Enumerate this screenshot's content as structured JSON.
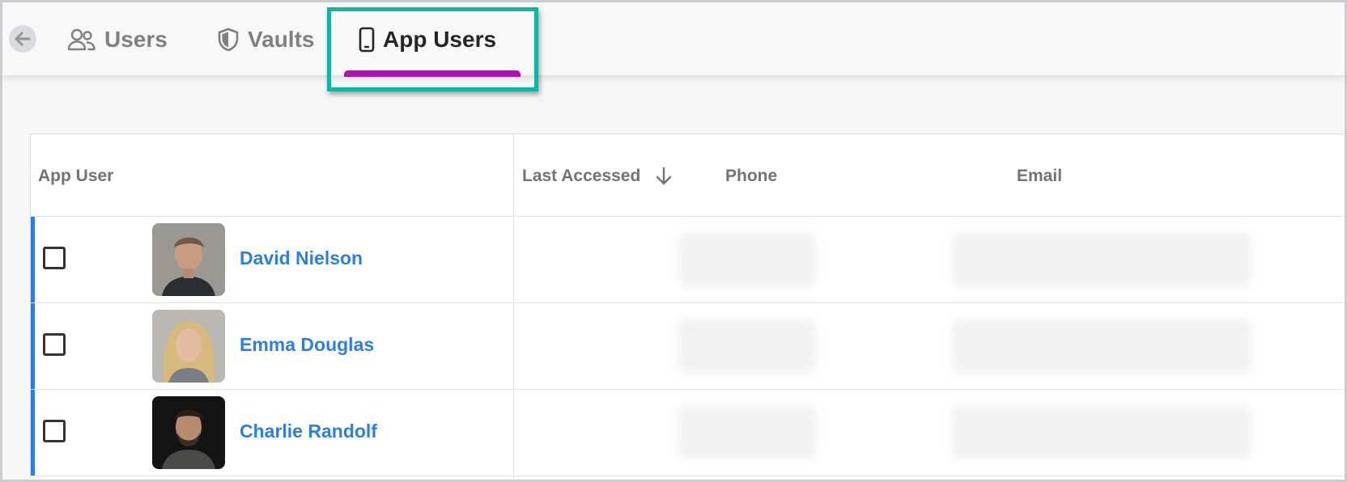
{
  "nav": {
    "back_icon": "arrow-left-icon",
    "tabs": [
      {
        "label": "Users",
        "icon": "users-icon",
        "active": false
      },
      {
        "label": "Vaults",
        "icon": "shield-icon",
        "active": false
      },
      {
        "label": "App Users",
        "icon": "mobile-phone-icon",
        "active": true
      }
    ],
    "accent_color": "#b50fb0",
    "highlight_color": "#13b3a1"
  },
  "table": {
    "columns": {
      "app_user": "App User",
      "last_accessed": "Last Accessed",
      "phone": "Phone",
      "email": "Email"
    },
    "sort_icon": "arrow-down-icon",
    "rows": [
      {
        "name": "David Nielson"
      },
      {
        "name": "Emma Douglas"
      },
      {
        "name": "Charlie Randolf"
      }
    ],
    "link_color": "#2c7fe0",
    "row_accent_color": "#2f7de1"
  }
}
